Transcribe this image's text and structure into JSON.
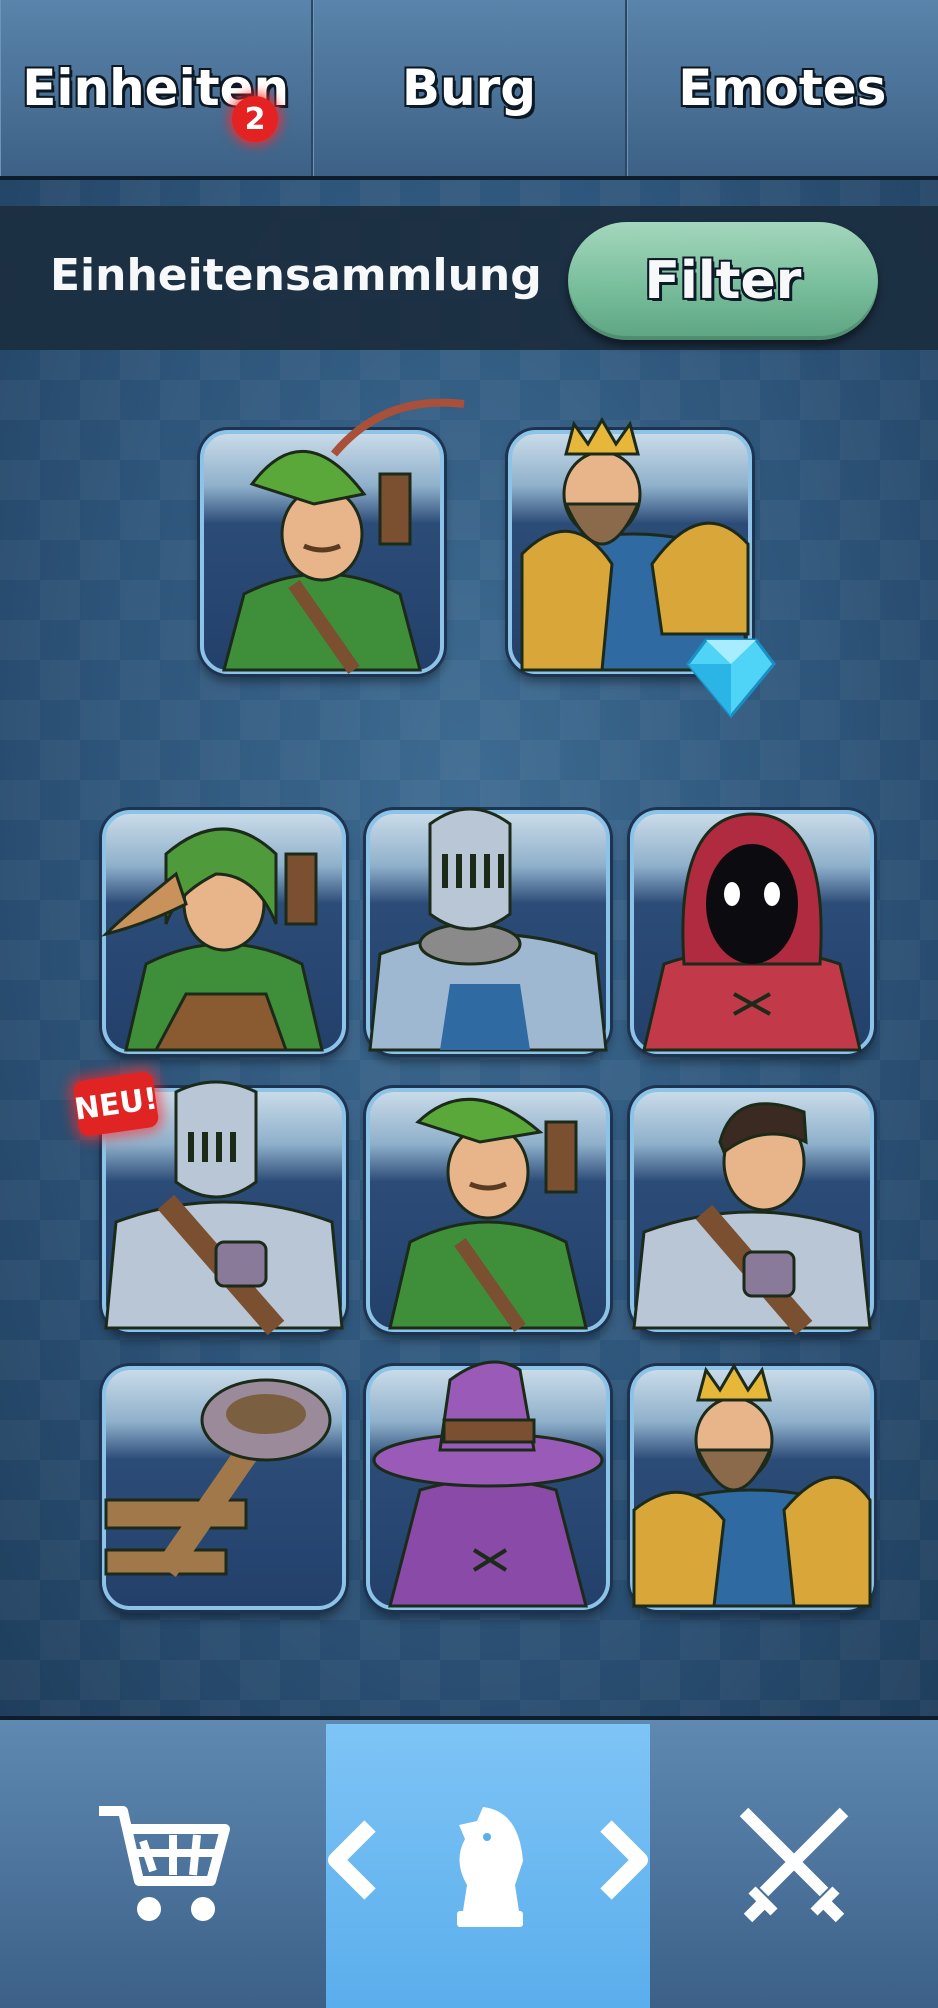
{
  "tabs": [
    {
      "label": "Einheiten",
      "badge": "2"
    },
    {
      "label": "Burg"
    },
    {
      "label": "Emotes"
    }
  ],
  "collection": {
    "title": "Einheitensammlung",
    "filter_label": "Filter"
  },
  "featured_units": [
    {
      "name": "archer-green-hood"
    },
    {
      "name": "king-gold-armor",
      "reward": "diamond-icon"
    }
  ],
  "units": [
    {
      "name": "elf-archer"
    },
    {
      "name": "knight-steel-helmet"
    },
    {
      "name": "hooded-mage-red"
    },
    {
      "name": "armored-knight",
      "tag": "NEU!"
    },
    {
      "name": "archer-green-hood"
    },
    {
      "name": "soldier-dark-hair"
    },
    {
      "name": "catapult"
    },
    {
      "name": "witch-purple"
    },
    {
      "name": "king-gold-armor"
    }
  ],
  "bottom_nav": [
    {
      "icon": "cart-icon"
    },
    {
      "icon": "knight-chess-icon",
      "active": true,
      "prev": "chevron-left-icon",
      "next": "chevron-right-icon"
    },
    {
      "icon": "crossed-swords-icon"
    }
  ],
  "colors": {
    "active_nav": "#6cb9f2",
    "filter_button": "#7cc39e",
    "badge": "#e52222"
  }
}
